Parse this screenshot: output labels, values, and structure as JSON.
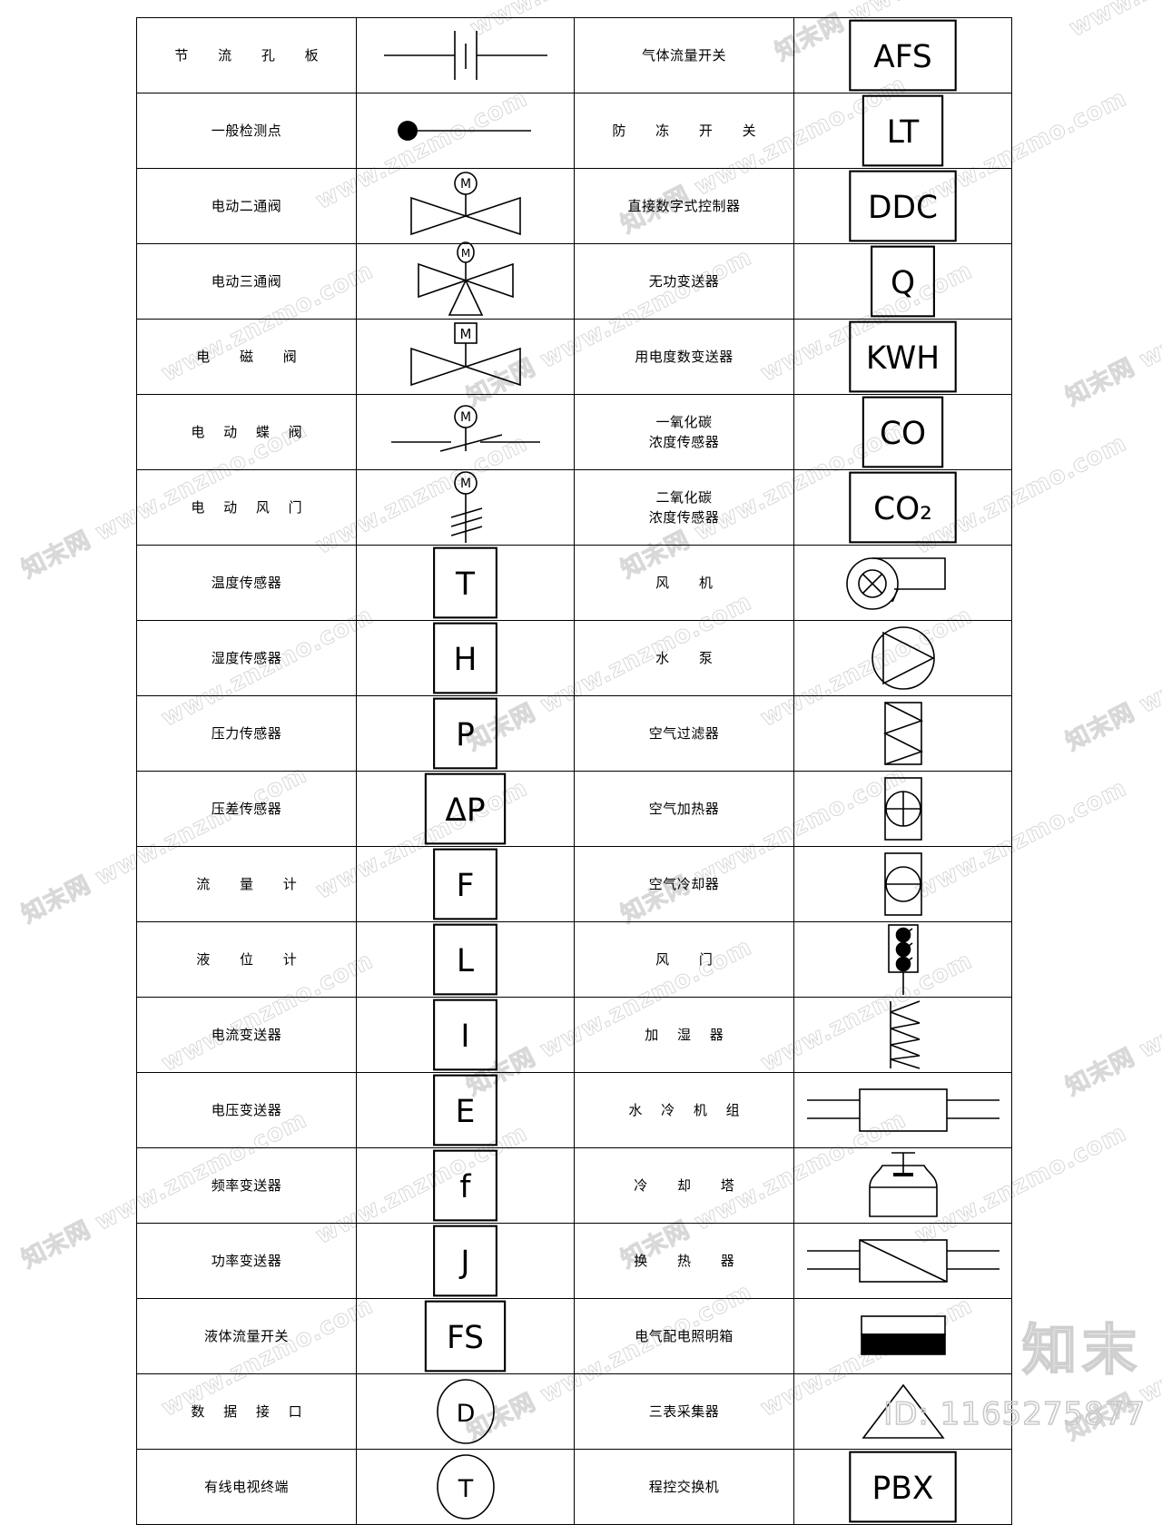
{
  "document": {
    "kind": "HVAC / BA control symbol legend table",
    "columns": 4,
    "rows": 19,
    "line_color": "#000000",
    "background": "#ffffff"
  },
  "watermarks": {
    "tiles": [
      "www.znzmo.com",
      "知末网 www.znzmo.com"
    ],
    "brand": "知末",
    "id_label": "ID: 1165275877",
    "color": "#d8d8d8"
  },
  "rows": [
    {
      "left_label": "节 流 孔 板",
      "left_spacing": "wide",
      "left_symbol": "orifice-plate",
      "right_label": "气体流量开关",
      "right_spacing": "none",
      "right_symbol": "box-text",
      "right_text": "AFS"
    },
    {
      "left_label": "一般检测点",
      "left_spacing": "none",
      "left_symbol": "test-point",
      "right_label": "防 冻 开 关",
      "right_spacing": "wide",
      "right_symbol": "box-text",
      "right_text": "LT"
    },
    {
      "left_label": "电动二通阀",
      "left_spacing": "none",
      "left_symbol": "motor-two-way-valve",
      "right_label": "直接数字式控制器",
      "right_spacing": "none",
      "right_symbol": "box-text",
      "right_text": "DDC"
    },
    {
      "left_label": "电动三通阀",
      "left_spacing": "none",
      "left_symbol": "motor-three-way-valve",
      "right_label": "无功变送器",
      "right_spacing": "none",
      "right_symbol": "box-text",
      "right_text": "Q"
    },
    {
      "left_label": "电 磁 阀",
      "left_spacing": "wide",
      "left_symbol": "solenoid-valve",
      "right_label": "用电度数变送器",
      "right_spacing": "none",
      "right_symbol": "box-text",
      "right_text": "KWH"
    },
    {
      "left_label": "电 动 蝶 阀",
      "left_spacing": "mid",
      "left_symbol": "motor-butterfly-valve",
      "right_label": "一氧化碳",
      "right_label2": "浓度传感器",
      "right_spacing": "none",
      "right_symbol": "box-text",
      "right_text": "CO"
    },
    {
      "left_label": "电 动 风 门",
      "left_spacing": "mid",
      "left_symbol": "motor-damper",
      "right_label": "二氧化碳",
      "right_label2": "浓度传感器",
      "right_spacing": "none",
      "right_symbol": "box-text",
      "right_text": "CO₂"
    },
    {
      "left_label": "温度传感器",
      "left_spacing": "none",
      "left_symbol": "box-text",
      "left_text": "T",
      "right_label": "风    机",
      "right_spacing": "wide",
      "right_symbol": "fan"
    },
    {
      "left_label": "湿度传感器",
      "left_spacing": "none",
      "left_symbol": "box-text",
      "left_text": "H",
      "right_label": "水    泵",
      "right_spacing": "wide",
      "right_symbol": "pump"
    },
    {
      "left_label": "压力传感器",
      "left_spacing": "none",
      "left_symbol": "box-text",
      "left_text": "P",
      "right_label": "空气过滤器",
      "right_spacing": "none",
      "right_symbol": "air-filter"
    },
    {
      "left_label": "压差传感器",
      "left_spacing": "none",
      "left_symbol": "box-text",
      "left_text": "ΔP",
      "right_label": "空气加热器",
      "right_spacing": "none",
      "right_symbol": "air-heater"
    },
    {
      "left_label": "流 量 计",
      "left_spacing": "wide",
      "left_symbol": "box-text",
      "left_text": "F",
      "right_label": "空气冷却器",
      "right_spacing": "none",
      "right_symbol": "air-cooler"
    },
    {
      "left_label": "液 位 计",
      "left_spacing": "wide",
      "left_symbol": "box-text",
      "left_text": "L",
      "right_label": "风    门",
      "right_spacing": "wide",
      "right_symbol": "damper"
    },
    {
      "left_label": "电流变送器",
      "left_spacing": "none",
      "left_symbol": "box-text",
      "left_text": "I",
      "right_label": "加 湿 器",
      "right_spacing": "mid",
      "right_symbol": "humidifier"
    },
    {
      "left_label": "电压变送器",
      "left_spacing": "none",
      "left_symbol": "box-text",
      "left_text": "E",
      "right_label": "水 冷 机 组",
      "right_spacing": "mid",
      "right_symbol": "water-chiller"
    },
    {
      "left_label": "频率变送器",
      "left_spacing": "none",
      "left_symbol": "box-text",
      "left_text": "f",
      "right_label": "冷 却 塔",
      "right_spacing": "wide",
      "right_symbol": "cooling-tower"
    },
    {
      "left_label": "功率变送器",
      "left_spacing": "none",
      "left_symbol": "box-text",
      "left_text": "J",
      "right_label": "换 热 器",
      "right_spacing": "wide",
      "right_symbol": "heat-exchanger"
    },
    {
      "left_label": "液体流量开关",
      "left_spacing": "none",
      "left_symbol": "box-text",
      "left_text": "FS",
      "right_label": "电气配电照明箱",
      "right_spacing": "none",
      "right_symbol": "distribution-box"
    },
    {
      "left_label": "数 据 接 口",
      "left_spacing": "mid",
      "left_symbol": "circle-text",
      "left_text": "D",
      "right_label": "三表采集器",
      "right_spacing": "none",
      "right_symbol": "meter-collector"
    },
    {
      "left_label": "有线电视终端",
      "left_spacing": "none",
      "left_symbol": "circle-text",
      "left_text": "T",
      "right_label": "程控交换机",
      "right_spacing": "none",
      "right_symbol": "box-text",
      "right_text": "PBX"
    }
  ]
}
